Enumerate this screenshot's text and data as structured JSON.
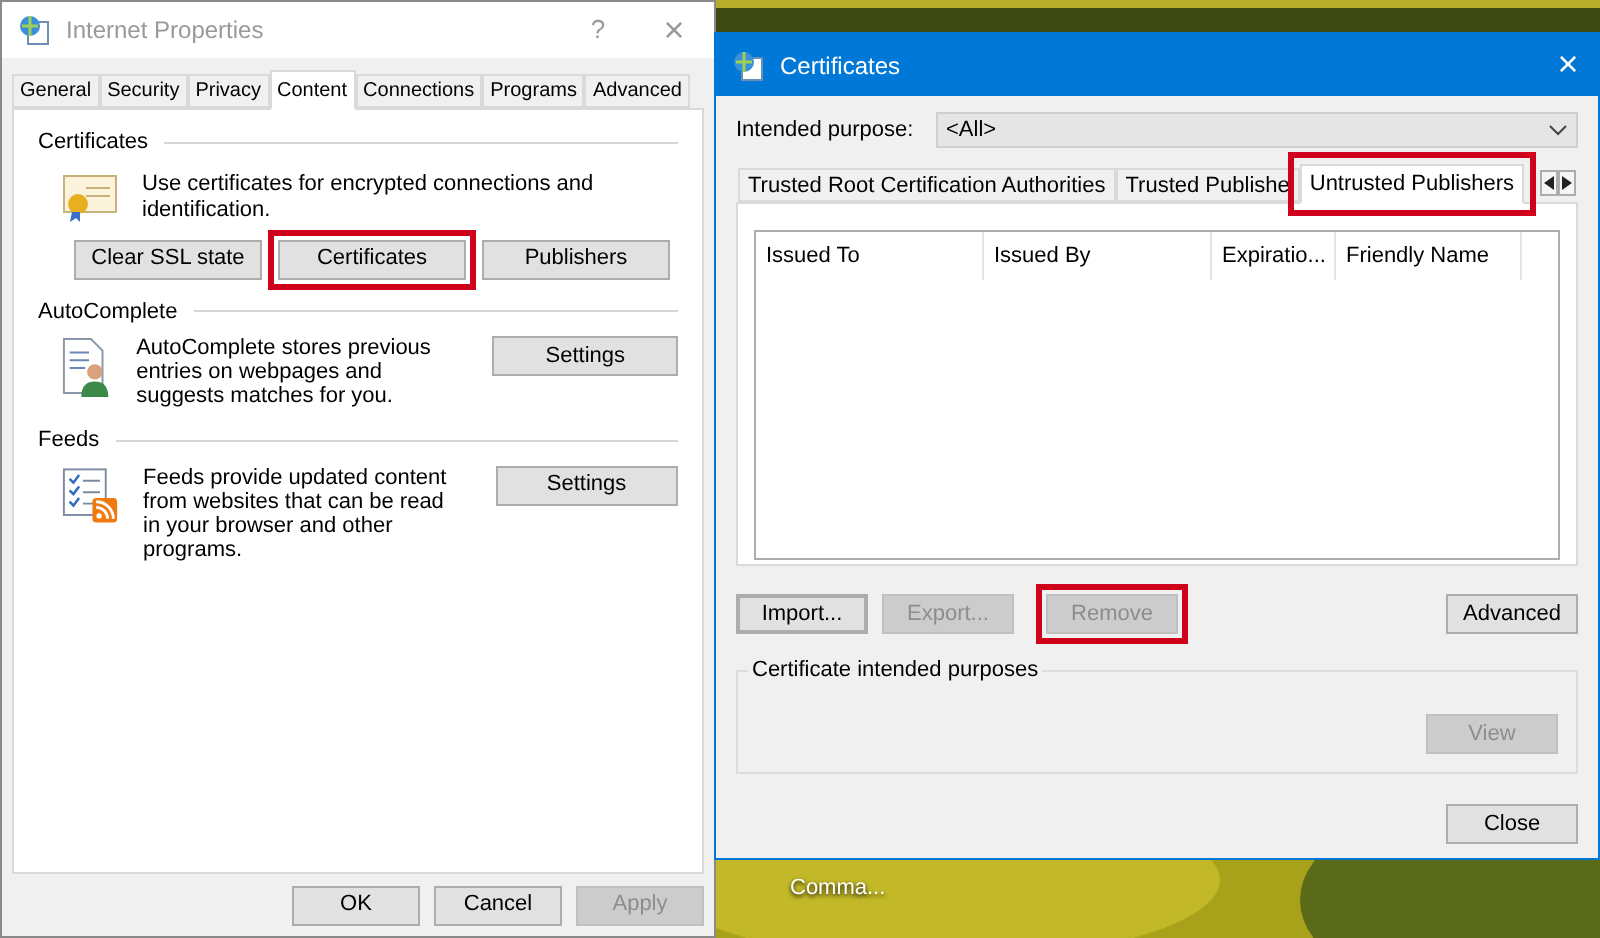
{
  "desktop": {
    "icons": [
      {
        "label": "Comma..."
      }
    ]
  },
  "internet_properties": {
    "title": "Internet Properties",
    "help": "?",
    "close": "×",
    "tabs": [
      {
        "label": "General",
        "selected": false
      },
      {
        "label": "Security",
        "selected": false
      },
      {
        "label": "Privacy",
        "selected": false
      },
      {
        "label": "Content",
        "selected": true
      },
      {
        "label": "Connections",
        "selected": false
      },
      {
        "label": "Programs",
        "selected": false
      },
      {
        "label": "Advanced",
        "selected": false
      }
    ],
    "sections": [
      {
        "kind": "button_row",
        "heading": "Certificates",
        "text": "Use certificates for encrypted connections and identification.",
        "buttons": [
          {
            "label": "Clear SSL state",
            "disabled": false,
            "highlighted": false
          },
          {
            "label": "Certificates",
            "disabled": false,
            "highlighted": true
          },
          {
            "label": "Publishers",
            "disabled": false,
            "highlighted": false
          }
        ]
      },
      {
        "kind": "side_button",
        "heading": "AutoComplete",
        "text": "AutoComplete stores previous entries on webpages and suggests matches for you.",
        "buttons": [
          {
            "label": "Settings",
            "disabled": false,
            "highlighted": false
          }
        ]
      },
      {
        "kind": "side_button",
        "heading": "Feeds",
        "text": "Feeds provide updated content from websites that can be read in your browser and other programs.",
        "buttons": [
          {
            "label": "Settings",
            "disabled": false,
            "highlighted": false
          }
        ]
      }
    ],
    "footer_buttons": [
      {
        "label": "OK",
        "disabled": false
      },
      {
        "label": "Cancel",
        "disabled": false
      },
      {
        "label": "Apply",
        "disabled": true
      }
    ]
  },
  "certificates": {
    "title": "Certificates",
    "close": "×",
    "purpose_label": "Intended purpose:",
    "purpose_value": "<All>",
    "tabs": [
      {
        "label": "Trusted Root Certification Authorities",
        "selected": false,
        "highlighted": false
      },
      {
        "label": "Trusted Publishe",
        "selected": false,
        "highlighted": false
      },
      {
        "label": "Untrusted Publishers",
        "selected": true,
        "highlighted": true
      }
    ],
    "columns": [
      "Issued To",
      "Issued By",
      "Expiratio...",
      "Friendly Name"
    ],
    "action_buttons": [
      {
        "label": "Import...",
        "disabled": false,
        "focused": true,
        "highlighted": false
      },
      {
        "label": "Export...",
        "disabled": true,
        "focused": false,
        "highlighted": false
      },
      {
        "label": "Remove",
        "disabled": true,
        "focused": false,
        "highlighted": true
      }
    ],
    "advanced_button": {
      "label": "Advanced",
      "disabled": false
    },
    "purposes_group": {
      "label": "Certificate intended purposes",
      "view_button": {
        "label": "View",
        "disabled": true
      }
    },
    "close_button": {
      "label": "Close",
      "disabled": false
    }
  }
}
